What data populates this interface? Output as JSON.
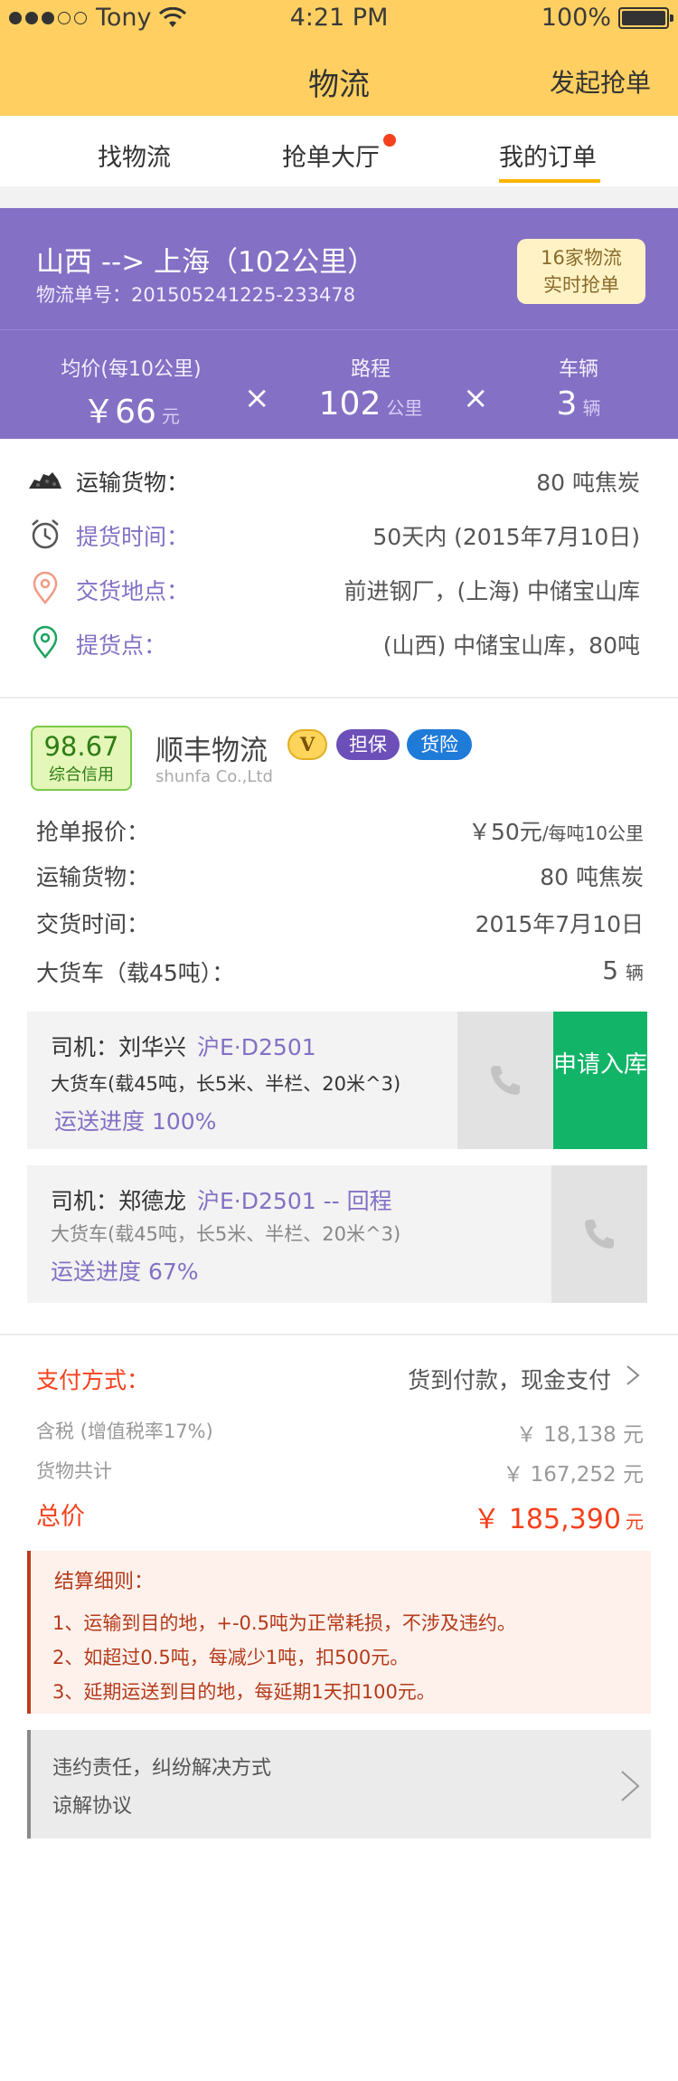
{
  "status_bar": {
    "carrier": "Tony",
    "time": "4:21 PM",
    "battery": "100%"
  },
  "nav": {
    "title": "物流",
    "action": "发起抢单"
  },
  "tabs": [
    {
      "label": "找物流",
      "active": false
    },
    {
      "label": "抢单大厅",
      "active": false,
      "has_dot": true
    },
    {
      "label": "我的订单",
      "active": true
    }
  ],
  "route": {
    "title": "山西 --> 上海（102公里）",
    "order_no": "物流单号：201505241225-233478",
    "grab_badge_line1": "16家物流",
    "grab_badge_line2": "实时抢单",
    "stats": [
      {
        "label": "均价(每10公里)",
        "value": "￥66",
        "unit": "元"
      },
      {
        "label": "路程",
        "value": "102",
        "unit": "公里"
      },
      {
        "label": "车辆",
        "value": "3",
        "unit": "辆"
      }
    ],
    "multiply": "×"
  },
  "cargo": [
    {
      "icon": "coal-icon",
      "label": "运输货物：",
      "value": "80 吨焦炭"
    },
    {
      "icon": "alarm-clock-icon",
      "label": "提货时间：",
      "value": "50天内 (2015年7月10日)"
    },
    {
      "icon": "location-pin-icon",
      "label": "交货地点：",
      "value": "前进钢厂，(上海) 中储宝山库"
    },
    {
      "icon": "location-pin-icon",
      "label": "提货点：",
      "value": "(山西) 中储宝山库，80吨"
    }
  ],
  "company": {
    "credit_score": "98.67",
    "credit_label": "综合信用",
    "name": "顺丰物流",
    "name_en": "shunfa Co.,Ltd",
    "badges": {
      "v": "V",
      "guarantee": "担保",
      "insurance": "货险"
    },
    "quote_label": "抢单报价：",
    "quote_value": "￥50元",
    "quote_unit": "/每吨10公里",
    "goods_label": "运输货物：",
    "goods_value": "80 吨焦炭",
    "delivery_label": "交货时间：",
    "delivery_value": "2015年7月10日",
    "truck_label": "大货车（载45吨）：",
    "truck_count": "5",
    "truck_unit": "辆"
  },
  "drivers": [
    {
      "name": "司机：刘华兴",
      "plate": "沪E·D2501",
      "truck": "大货车(载45吨，长5米、半栏、20米^3)",
      "progress_text": "运送进度 100%",
      "progress": 100,
      "action": "申请入库"
    },
    {
      "name": "司机：郑德龙",
      "plate": "沪E·D2501 -- 回程",
      "truck": "大货车(载45吨，长5米、半栏、20米^3)",
      "progress_text": "运送进度 67%",
      "progress": 67
    }
  ],
  "payment": {
    "method_label": "支付方式：",
    "method_value": "货到付款，现金支付",
    "tax_label": "含税 (增值税率17%)",
    "tax_value": "￥ 18,138 元",
    "goods_total_label": "货物共计",
    "goods_total_value": "￥ 167,252 元",
    "total_label": "总价",
    "total_value": "￥ 185,390",
    "total_unit": "元"
  },
  "rules": {
    "title": "结算细则：",
    "items": [
      "1、运输到目的地，+-0.5吨为正常耗损，不涉及违约。",
      "2、如超过0.5吨，每减少1吨，扣500元。",
      "3、延期运送到目的地，每延期1天扣100元。"
    ]
  },
  "terms": {
    "line1": "违约责任，纠纷解决方式",
    "line2": "谅解协议"
  },
  "colors": {
    "nav_bg": "#FFD061",
    "banner": "#8470C4",
    "accent_orange": "#F5411C",
    "apply_green": "#12B568",
    "tab_underline": "#FFB400"
  }
}
